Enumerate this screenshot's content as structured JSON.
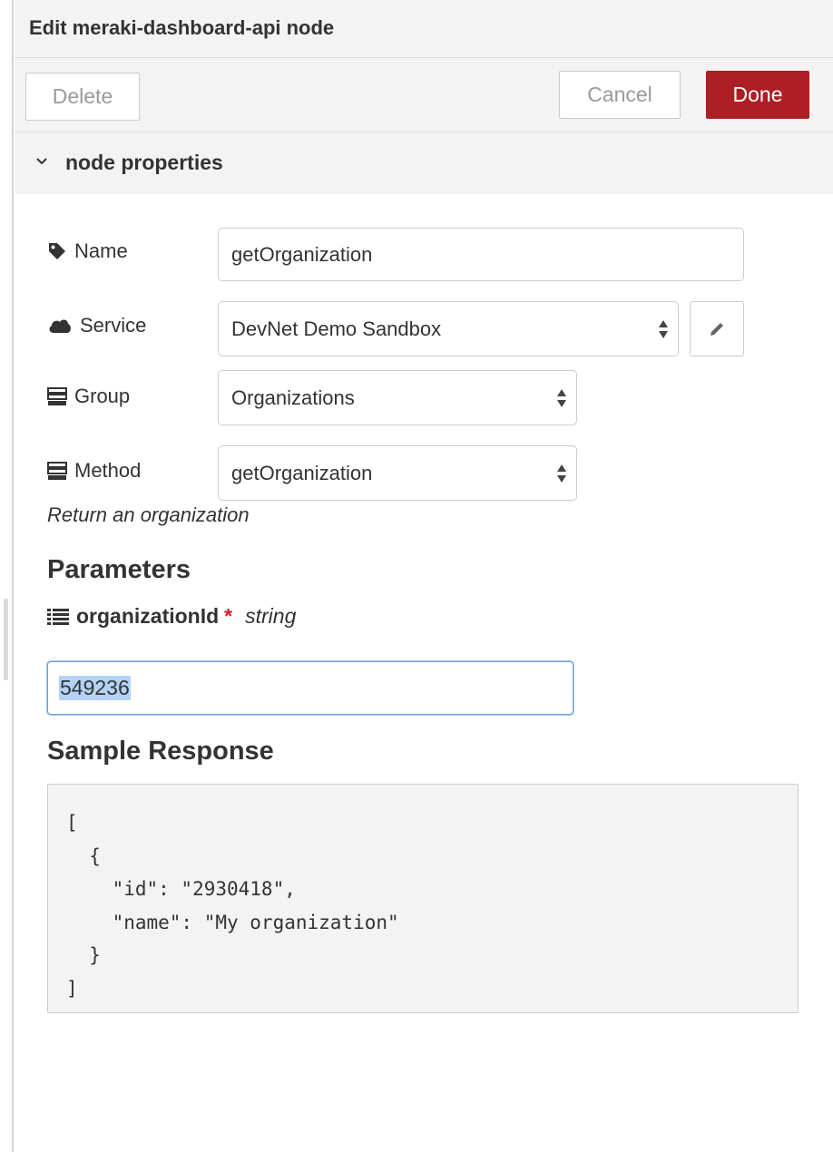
{
  "tray": {
    "title": "Edit meraki-dashboard-api node"
  },
  "toolbar": {
    "delete_label": "Delete",
    "cancel_label": "Cancel",
    "done_label": "Done"
  },
  "section": {
    "title": "node properties"
  },
  "form": {
    "name": {
      "label": "Name",
      "value": "getOrganization",
      "icon": "tag-icon"
    },
    "service": {
      "label": "Service",
      "value": "DevNet Demo Sandbox",
      "icon": "cloud-icon",
      "edit_icon": "pencil-icon"
    },
    "group": {
      "label": "Group",
      "value": "Organizations",
      "icon": "tasks-icon"
    },
    "method": {
      "label": "Method",
      "value": "getOrganization",
      "icon": "tasks-icon"
    },
    "description": "Return an organization"
  },
  "parameters": {
    "heading": "Parameters",
    "items": [
      {
        "name": "organizationId",
        "required_mark": "*",
        "type": "string",
        "value": "549236",
        "icon": "list-icon"
      }
    ]
  },
  "sample": {
    "heading": "Sample Response",
    "body": "[\n  {\n    \"id\": \"2930418\",\n    \"name\": \"My organization\"\n  }\n]"
  },
  "colors": {
    "done_button": "#ad1e25",
    "header_bg": "#f3f3f3",
    "required": "#d61f26",
    "focus_border": "#6aa0d8",
    "selection": "#b3d3f6"
  }
}
